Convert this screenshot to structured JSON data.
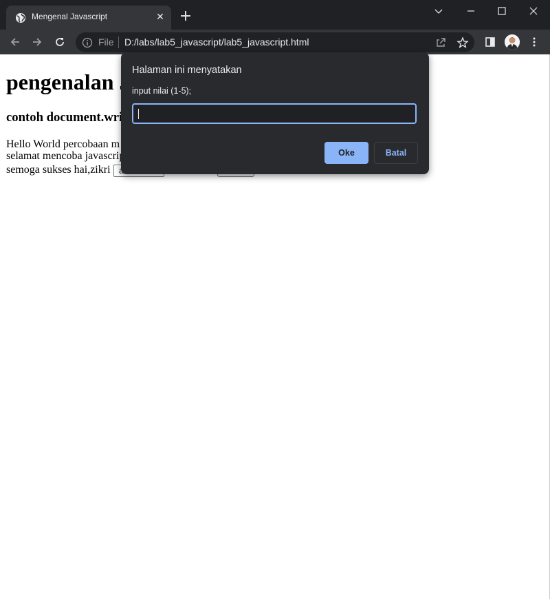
{
  "tab": {
    "title": "Mengenal Javascript"
  },
  "omnibox": {
    "scheme": "File",
    "url": "D:/labs/lab5_javascript/lab5_javascript.html"
  },
  "page": {
    "heading": "pengenalan J",
    "subheading": "contoh document.wri",
    "line1": "Hello World percobaan m",
    "line2": "selamat mencoba javascrip",
    "line3": "semoga sukses hai,zikri",
    "input_value": "a"
  },
  "dialog": {
    "title": "Halaman ini menyatakan",
    "message": "input nilai (1-5);",
    "input_value": "",
    "ok_label": "Oke",
    "cancel_label": "Batal"
  },
  "colors": {
    "chrome_dark": "#202124",
    "toolbar": "#35363a",
    "accent": "#8ab4f8",
    "dialog_bg": "#292a2d"
  }
}
